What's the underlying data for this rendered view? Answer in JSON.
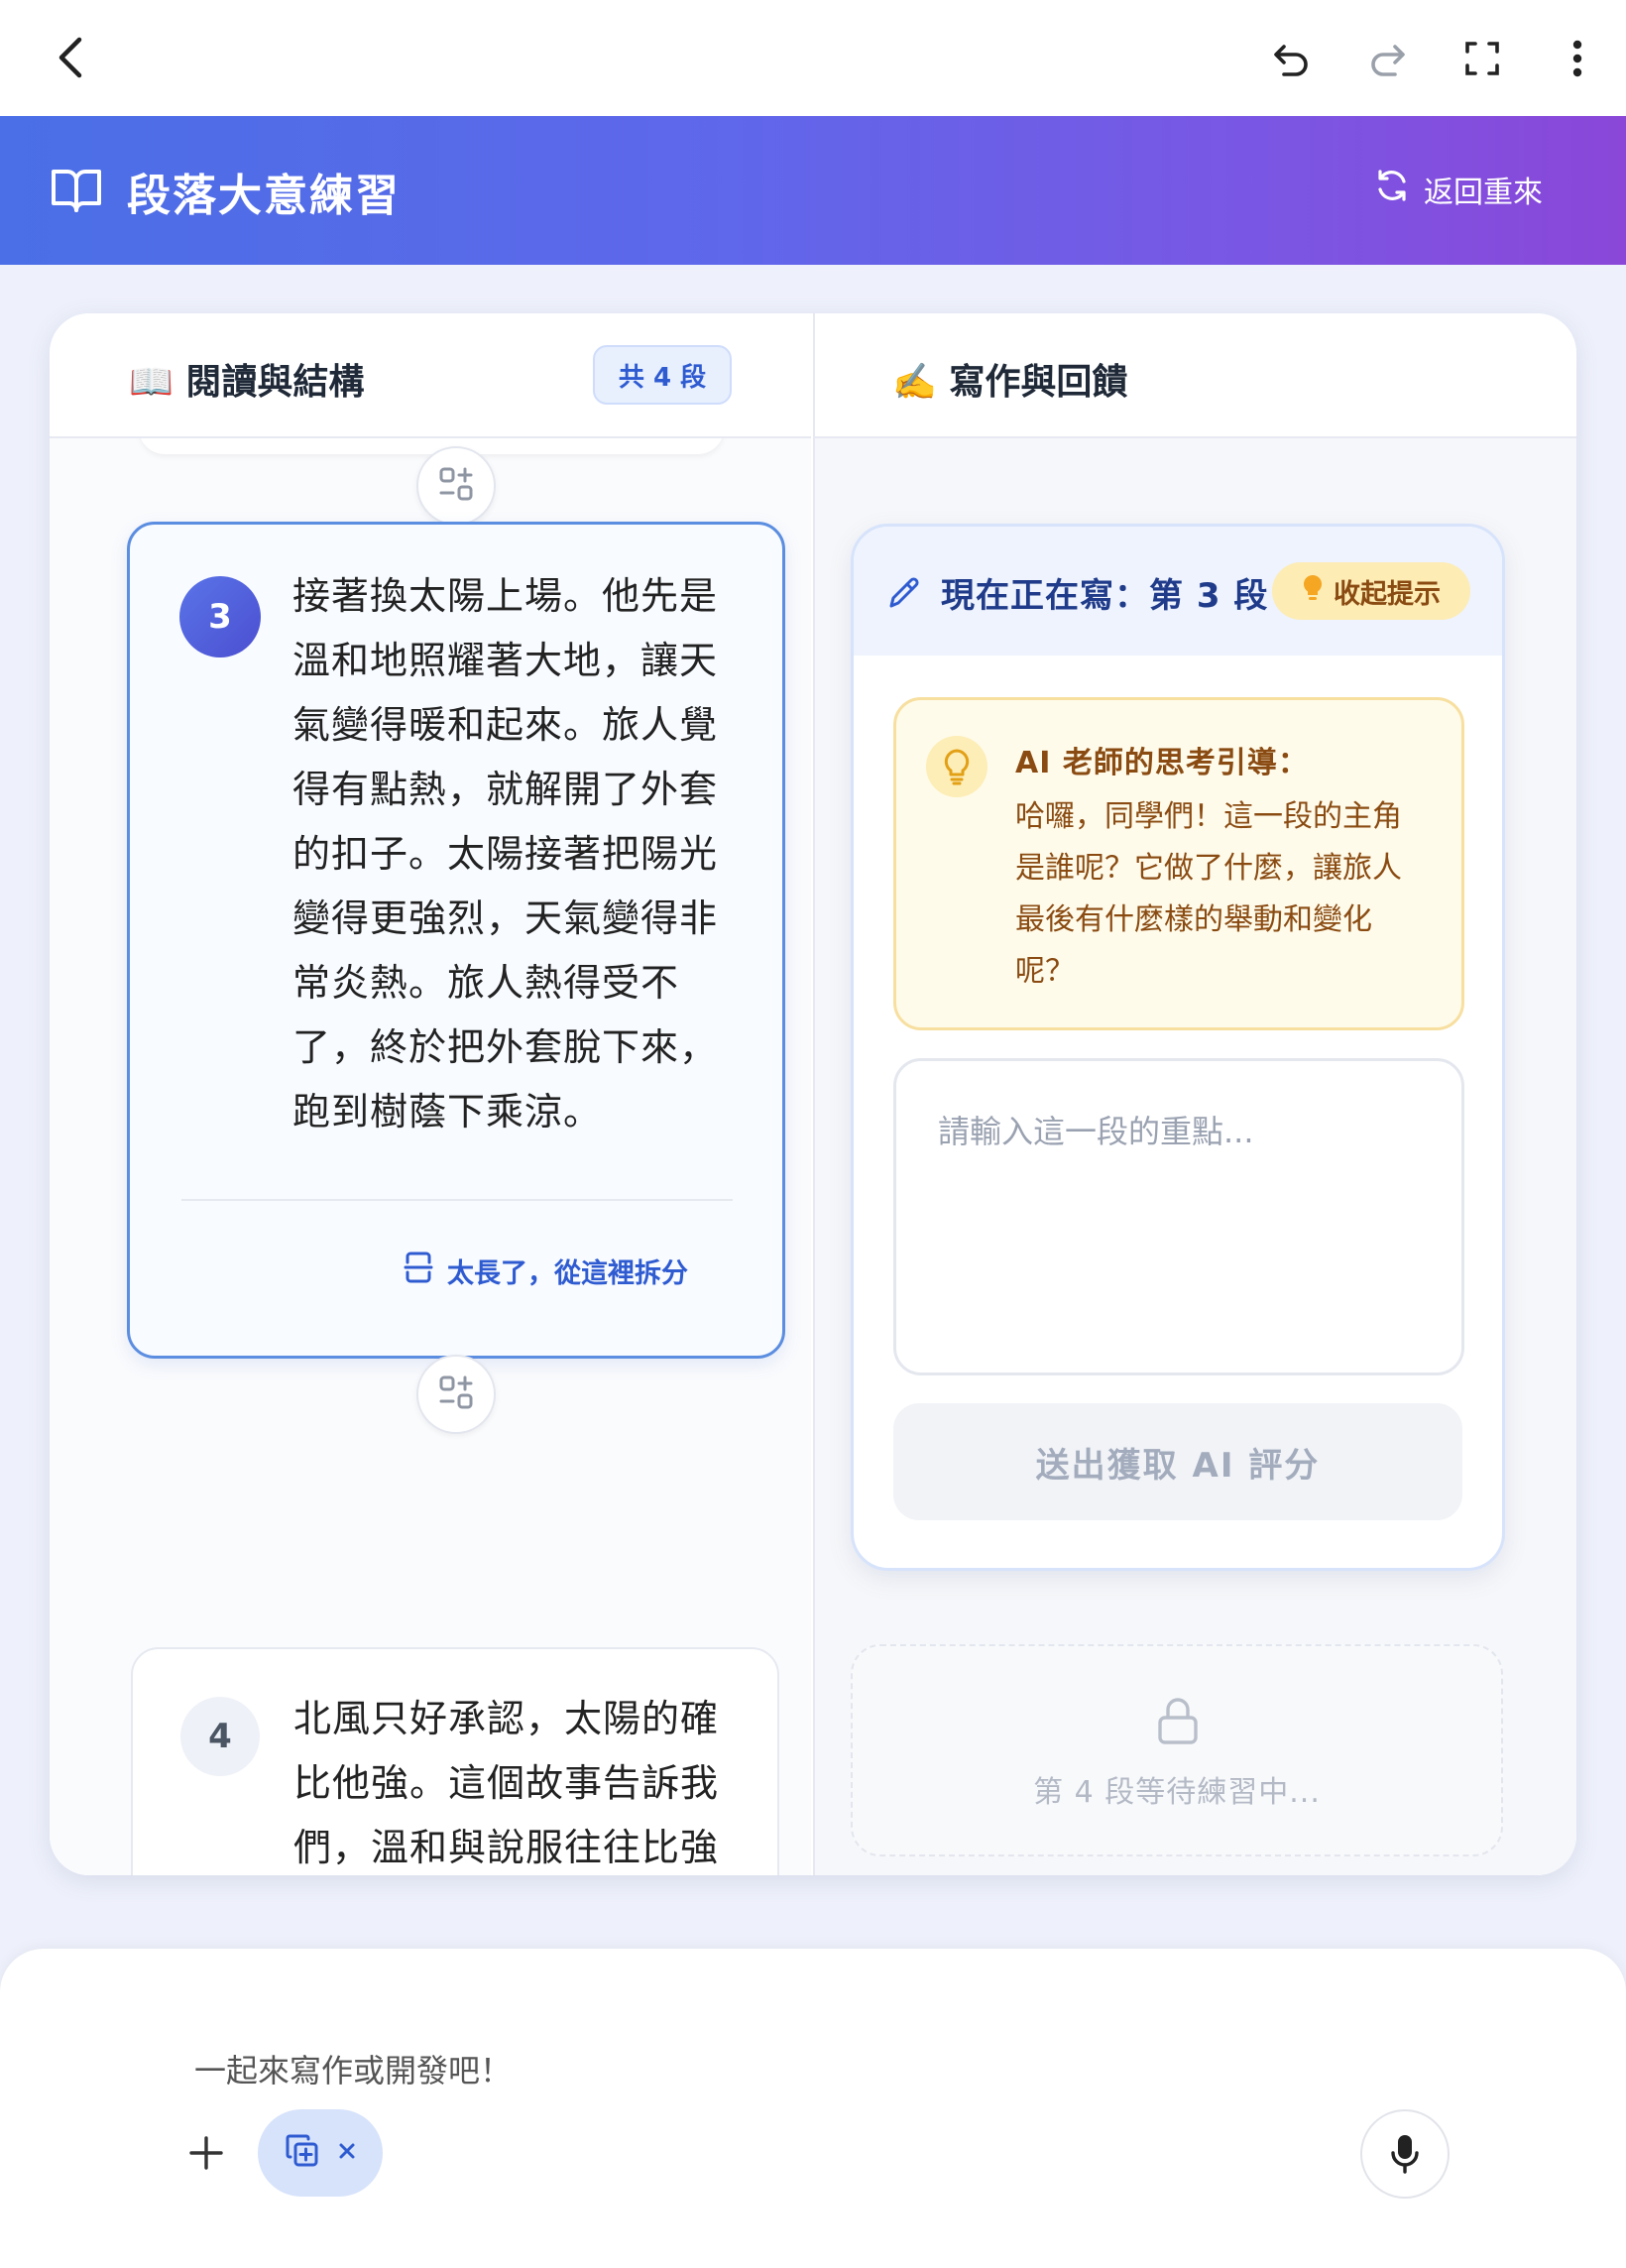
{
  "topbar": {
    "back_icon": "chevron-left-icon",
    "undo_icon": "undo-icon",
    "redo_icon": "redo-icon",
    "fullscreen_icon": "fullscreen-icon",
    "more_icon": "more-vertical-icon"
  },
  "header": {
    "title": "段落大意練習",
    "title_icon": "open-book-icon",
    "restart_label": "返回重來",
    "restart_icon": "refresh-icon"
  },
  "left_panel": {
    "title": "📖 閱讀與結構",
    "count_badge": "共 4 段",
    "paragraphs": [
      {
        "number": "3",
        "text": "接著換太陽上場。他先是溫和地照耀著大地，讓天氣變得暖和起來。旅人覺得有點熱，就解開了外套的扣子。太陽接著把陽光變得更強烈，天氣變得非常炎熱。旅人熱得受不了，終於把外套脫下來，跑到樹蔭下乘涼。",
        "lines": [
          "接著換太陽上場。他先是",
          "溫和地照耀著大地，讓天",
          "氣變得暖和起來。旅人覺",
          "得有點熱，就解開了外套",
          "的扣子。太陽接著把陽光",
          "變得更強烈，天氣變得非",
          "常炎熱。旅人熱得受不",
          "了，終於把外套脫下來，",
          "跑到樹蔭下乘涼。"
        ],
        "split_label": "太長了，從這裡拆分"
      },
      {
        "number": "4",
        "lines": [
          "北風只好承認，太陽的確",
          "比他強。這個故事告訴我",
          "們，溫和與說服往往比強"
        ]
      }
    ]
  },
  "right_panel": {
    "title": "✍️ 寫作與回饋",
    "writing_label": "現在正在寫：第 3 段",
    "collapse_hint_label": "收起提示",
    "hint_title": "AI 老師的思考引導：",
    "hint_text": "哈囉，同學們！這一段的主角是誰呢？它做了什麼，讓旅人最後有什麼樣的舉動和變化呢？",
    "hint_lines": [
      "哈囉，同學們！這一段的主角",
      "是誰呢？它做了什麼，讓旅人",
      "最後有什麼樣的舉動和變化",
      "呢？"
    ],
    "answer_placeholder": "請輸入這一段的重點...",
    "submit_label": "送出獲取 AI 評分",
    "locked_label": "第 4 段等待練習中..."
  },
  "composer": {
    "placeholder": "一起來寫作或開發吧！",
    "add_icon": "plus-icon",
    "attachment_icon": "add-copy-icon",
    "remove_icon": "close-icon",
    "mic_icon": "microphone-icon"
  },
  "colors": {
    "header_start": "#4a6fe6",
    "header_end": "#8a47d8",
    "accent_blue": "#2f5bd1",
    "hint_bg": "#fffbea",
    "hint_text": "#8a4b12"
  }
}
